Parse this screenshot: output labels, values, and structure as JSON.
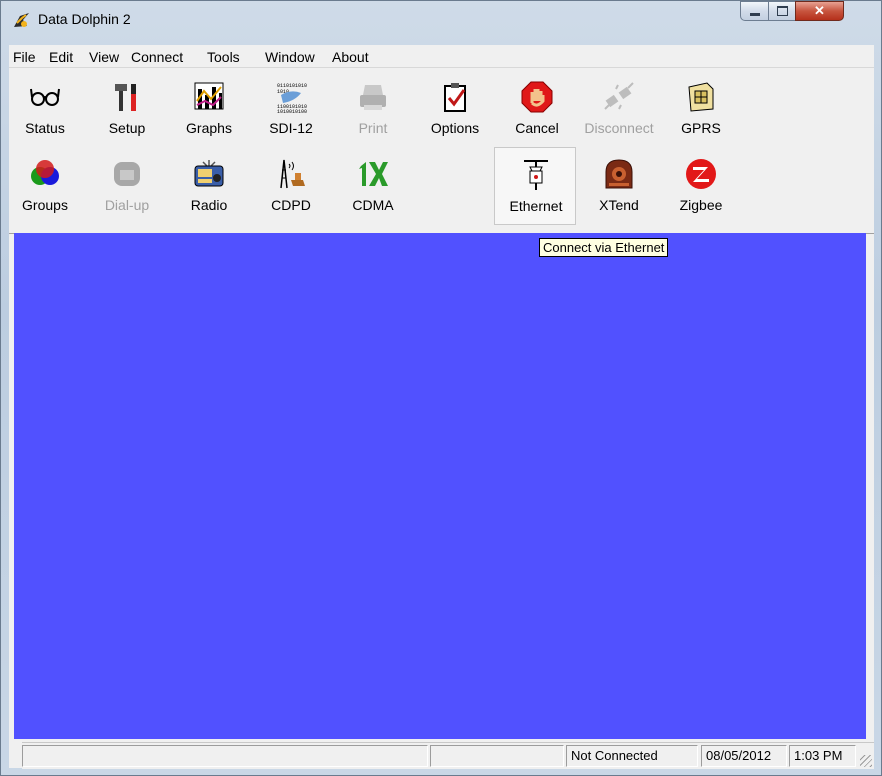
{
  "window": {
    "title": "Data Dolphin 2"
  },
  "menubar": {
    "items": [
      "File",
      "Edit",
      "View",
      "Connect",
      "Tools",
      "Window",
      "About"
    ]
  },
  "toolbar": {
    "row1": [
      {
        "label": "Status",
        "icon": "glasses-icon",
        "enabled": true
      },
      {
        "label": "Setup",
        "icon": "tools-icon",
        "enabled": true
      },
      {
        "label": "Graphs",
        "icon": "bar-graph-icon",
        "enabled": true
      },
      {
        "label": "SDI-12",
        "icon": "sdi12-data-icon",
        "enabled": true
      },
      {
        "label": "Print",
        "icon": "printer-icon",
        "enabled": false
      },
      {
        "label": "Options",
        "icon": "clipboard-check-icon",
        "enabled": true
      },
      {
        "label": "Cancel",
        "icon": "stop-hand-icon",
        "enabled": true
      },
      {
        "label": "Disconnect",
        "icon": "plug-disconnect-icon",
        "enabled": false
      },
      {
        "label": "GPRS",
        "icon": "sim-card-icon",
        "enabled": true
      }
    ],
    "row2": [
      {
        "label": "Groups",
        "icon": "color-circles-icon",
        "enabled": true
      },
      {
        "label": "Dial-up",
        "icon": "telephone-icon",
        "enabled": false
      },
      {
        "label": "Radio",
        "icon": "radio-icon",
        "enabled": true
      },
      {
        "label": "CDPD",
        "icon": "antenna-tower-icon",
        "enabled": true
      },
      {
        "label": "CDMA",
        "icon": "cdma-1x-icon",
        "enabled": true
      },
      {
        "label": "Ethernet",
        "icon": "ethernet-plug-icon",
        "enabled": true
      },
      {
        "label": "XTend",
        "icon": "xtend-radio-icon",
        "enabled": true
      },
      {
        "label": "Zigbee",
        "icon": "zigbee-icon",
        "enabled": true
      }
    ]
  },
  "tooltip": {
    "text": "Connect via Ethernet"
  },
  "statusbar": {
    "connection": "Not Connected",
    "date": "08/05/2012",
    "time": "1:03 PM"
  },
  "colors": {
    "mdi_background": "#5151ff",
    "tooltip_bg": "#ffffe1"
  }
}
